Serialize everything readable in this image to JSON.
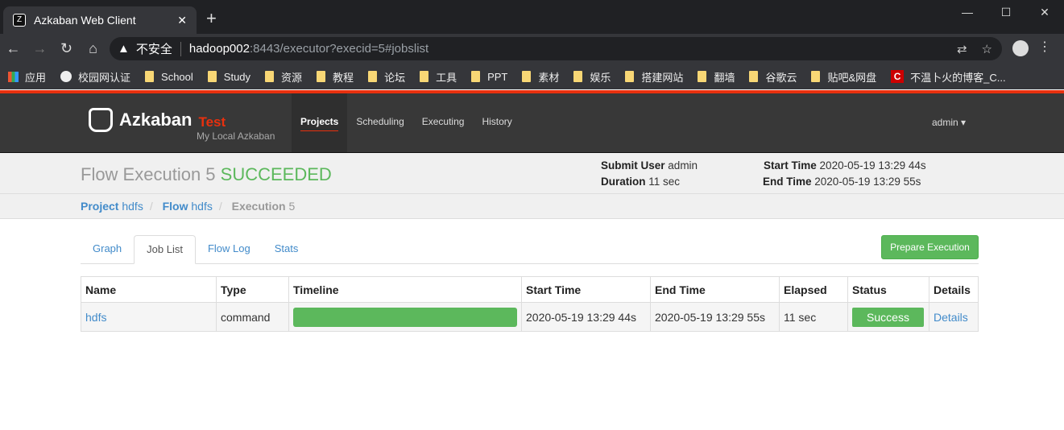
{
  "browser": {
    "tab_title": "Azkaban Web Client",
    "url_security": "不安全",
    "url_host": "hadoop002",
    "url_rest": ":8443/executor?execid=5#jobslist",
    "bookmarks": [
      "应用",
      "校园网认证",
      "School",
      "Study",
      "资源",
      "教程",
      "论坛",
      "工具",
      "PPT",
      "素材",
      "娱乐",
      "搭建网站",
      "翻墙",
      "谷歌云",
      "贴吧&网盘",
      "不温卜火的博客_C..."
    ]
  },
  "header": {
    "brand": "Azkaban",
    "env": "Test",
    "subtitle": "My Local Azkaban",
    "nav": [
      "Projects",
      "Scheduling",
      "Executing",
      "History"
    ],
    "active_nav": "Projects",
    "user": "admin"
  },
  "flow": {
    "title": "Flow Execution 5",
    "status": "SUCCEEDED",
    "submit_user_label": "Submit User",
    "submit_user": "admin",
    "duration_label": "Duration",
    "duration": "11 sec",
    "start_label": "Start Time",
    "start": "2020-05-19 13:29 44s",
    "end_label": "End Time",
    "end": "2020-05-19 13:29 55s"
  },
  "breadcrumb": {
    "project_label": "Project",
    "project": "hdfs",
    "flow_label": "Flow",
    "flow": "hdfs",
    "exec_label": "Execution",
    "exec": "5"
  },
  "tabs": [
    "Graph",
    "Job List",
    "Flow Log",
    "Stats"
  ],
  "active_tab": "Job List",
  "prepare_button": "Prepare Execution",
  "table": {
    "headers": [
      "Name",
      "Type",
      "Timeline",
      "Start Time",
      "End Time",
      "Elapsed",
      "Status",
      "Details"
    ],
    "rows": [
      {
        "name": "hdfs",
        "type": "command",
        "timeline_progress": 1.0,
        "start": "2020-05-19 13:29 44s",
        "end": "2020-05-19 13:29 55s",
        "elapsed": "11 sec",
        "status": "Success",
        "details": "Details"
      }
    ]
  },
  "colors": {
    "accent": "#e8300e",
    "success": "#5cb85c",
    "link": "#428bca"
  }
}
